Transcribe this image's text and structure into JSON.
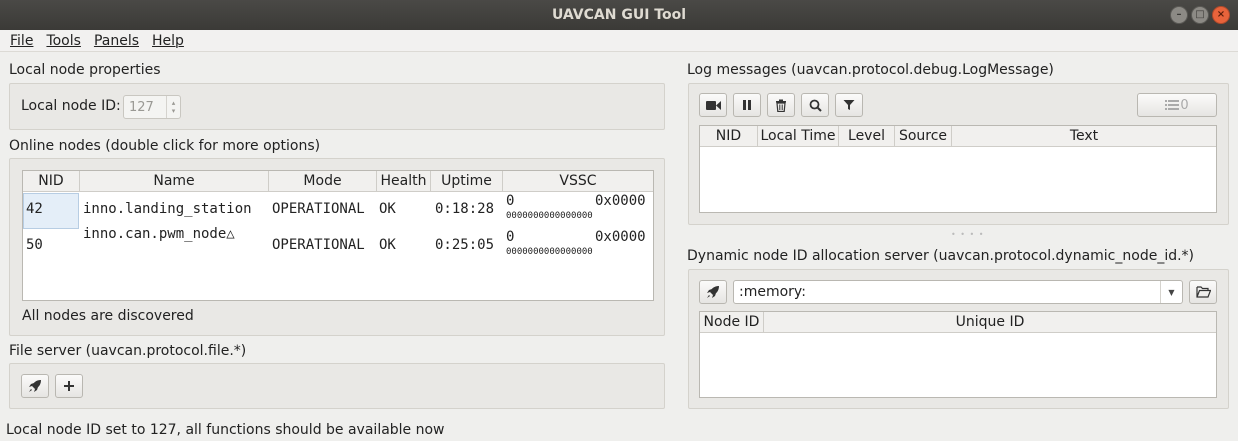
{
  "window": {
    "title": "UAVCAN GUI Tool"
  },
  "menu": [
    {
      "label": "File"
    },
    {
      "label": "Tools"
    },
    {
      "label": "Panels"
    },
    {
      "label": "Help"
    }
  ],
  "local_node": {
    "section_title": "Local node properties",
    "id_label": "Local node ID:",
    "id_value": "127"
  },
  "online_nodes": {
    "section_title": "Online nodes (double click for more options)",
    "columns": [
      "NID",
      "Name",
      "Mode",
      "Health",
      "Uptime",
      "VSSC"
    ],
    "rows": [
      {
        "nid": "42",
        "name": "inno.landing_station",
        "mode": "OPERATIONAL",
        "health": "OK",
        "uptime": "0:18:28",
        "vssc_dec": "0",
        "vssc_hex": "0x0000",
        "vssc_bits": "0000000000000000"
      },
      {
        "nid": "50",
        "name": "inno.can.pwm_node△",
        "mode": "OPERATIONAL",
        "health": "OK",
        "uptime": "0:25:05",
        "vssc_dec": "0",
        "vssc_hex": "0x0000",
        "vssc_bits": "0000000000000000"
      }
    ],
    "status": "All nodes are discovered"
  },
  "file_server": {
    "section_title": "File server (uavcan.protocol.file.*)"
  },
  "log": {
    "section_title": "Log messages (uavcan.protocol.debug.LogMessage)",
    "count": "0",
    "columns": [
      "NID",
      "Local Time",
      "Level",
      "Source",
      "Text"
    ]
  },
  "dynamic_alloc": {
    "section_title": "Dynamic node ID allocation server (uavcan.protocol.dynamic_node_id.*)",
    "storage": ":memory:",
    "columns": [
      "Node ID",
      "Unique ID"
    ]
  },
  "statusbar": {
    "text": "Local node ID set to 127, all functions should be available now"
  },
  "colors": {
    "titlebar": "#3b3a37",
    "close_button": "#e8633b",
    "selection": "#e4eef8"
  }
}
